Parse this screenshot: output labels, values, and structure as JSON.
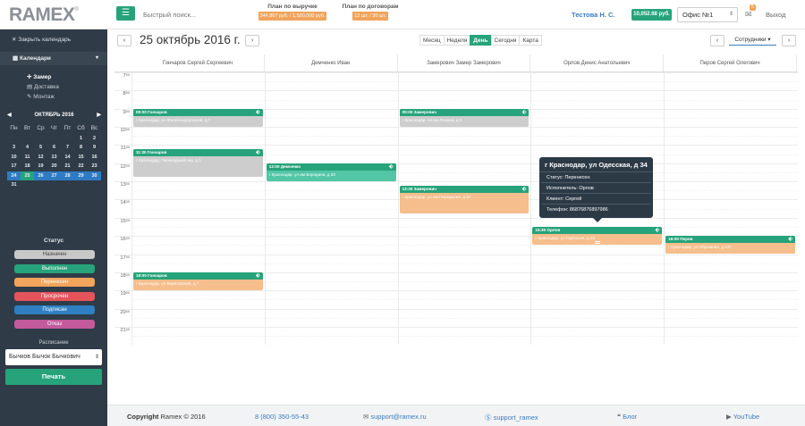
{
  "header": {
    "logo": "RAMEX",
    "logo_mark": "®",
    "search_placeholder": "Быстрый поиск...",
    "plan_revenue": {
      "title": "План по выручке",
      "value": "344,867 руб. / 1,500,000 руб."
    },
    "plan_contracts": {
      "title": "План по договорам",
      "value": "12 шт. / 30 шт."
    },
    "user": "Тестова Н. С.",
    "balance": "10,052.68 руб.",
    "office": "Офис №1",
    "mail_count": "5",
    "logout": "Выход"
  },
  "sidebar": {
    "close_calendar": "Закрыть календарь",
    "calendars": "Календари",
    "items": [
      "Замер",
      "Доставка",
      "Монтаж"
    ],
    "mini_cal": {
      "month": "ОКТЯБРЬ 2016",
      "dow": [
        "Пн",
        "Вт",
        "Ср",
        "Чт",
        "Пт",
        "Сб",
        "Вс"
      ],
      "weeks": [
        [
          "",
          "",
          "",
          "",
          "",
          "1",
          "2"
        ],
        [
          "3",
          "4",
          "5",
          "6",
          "7",
          "8",
          "9"
        ],
        [
          "10",
          "11",
          "12",
          "13",
          "14",
          "15",
          "16"
        ],
        [
          "17",
          "18",
          "19",
          "20",
          "21",
          "22",
          "23"
        ],
        [
          "24",
          "25",
          "26",
          "27",
          "28",
          "29",
          "30"
        ],
        [
          "31",
          "",
          "",
          "",
          "",
          "",
          ""
        ]
      ]
    },
    "status_title": "Статус",
    "statuses": [
      {
        "label": "Назначен",
        "color": "#c8c8c8"
      },
      {
        "label": "Выполнен",
        "color": "#26a37a"
      },
      {
        "label": "Перенесен",
        "color": "#f0a45c"
      },
      {
        "label": "Просрочен",
        "color": "#e4545a"
      },
      {
        "label": "Подписан",
        "color": "#2f7fc2"
      },
      {
        "label": "Отказ",
        "color": "#c35a9b"
      }
    ],
    "schedule_title": "Расписание",
    "schedule_value": "Бычков Бычок Бычкович",
    "print": "Печать"
  },
  "toolbar": {
    "date": "25 октябрь 2016 г.",
    "views": [
      "Месяц",
      "Неделя",
      "День",
      "Сегодня",
      "Карта"
    ],
    "active_view": "День",
    "staff": "Сотрудники ▾"
  },
  "calendar": {
    "columns": [
      "Гончаров Сергей Сергеевич",
      "Демченко Иван",
      "Замерович Замер Замерович",
      "Орлов Денис Анатольевич",
      "Перов Сергей Олегович"
    ],
    "hours": [
      "7",
      "8",
      "9",
      "10",
      "11",
      "12",
      "13",
      "14",
      "15",
      "16",
      "17",
      "18",
      "19",
      "20",
      "21"
    ],
    "events": [
      {
        "col": 0,
        "start": 9.0,
        "end": 10.0,
        "title": "09:00 Гончаров",
        "address": "г Краснодар, ул Железнодорожная, д 7",
        "status": "gray"
      },
      {
        "col": 0,
        "start": 11.25,
        "end": 12.75,
        "title": "11:30 Гончаров",
        "address": "г Краснодар, Переходный пер, д 1",
        "status": "gray"
      },
      {
        "col": 0,
        "start": 18.0,
        "end": 19.0,
        "title": "18:00 Гончаров",
        "address": "г Краснодар, ул Береговская, д 7",
        "status": "orange"
      },
      {
        "col": 1,
        "start": 12.0,
        "end": 13.0,
        "title": "12:00 Демченко",
        "address": "г Краснодар, ул им Бородина, д 63",
        "status": "teal"
      },
      {
        "col": 2,
        "start": 9.0,
        "end": 10.0,
        "title": "09:00 Замерович",
        "address": "г Краснодар, пл им Ленина, д 6",
        "status": "gray"
      },
      {
        "col": 2,
        "start": 13.25,
        "end": 14.75,
        "title": "13:30 Замерович",
        "address": "г Краснодар, ул им Передерия, д 67",
        "status": "orange"
      },
      {
        "col": 3,
        "start": 15.5,
        "end": 16.5,
        "title": "15:30 Орлов",
        "address": "г Краснодар, ул Одесская, д 34",
        "status": "orange"
      },
      {
        "col": 4,
        "start": 16.0,
        "end": 17.0,
        "title": "16:00 Перов",
        "address": "г Краснодар, ул Обрывная, д 237",
        "status": "orange"
      }
    ]
  },
  "popover": {
    "title": "г Краснодар, ул Одесская, д 34",
    "status": "Статус: Перенесен",
    "executor": "Исполнитель: Орлов",
    "client": "Клиент: Сергей",
    "phone": "Телефон: 86876876897986"
  },
  "footer": {
    "copyright_bold": "Copyright",
    "copyright_rest": "Ramex © 2016",
    "phone": "8 (800) 350-55-43",
    "email": "support@ramex.ru",
    "skype": "support_ramex",
    "blog": "Блог",
    "youtube": "YouTube"
  }
}
